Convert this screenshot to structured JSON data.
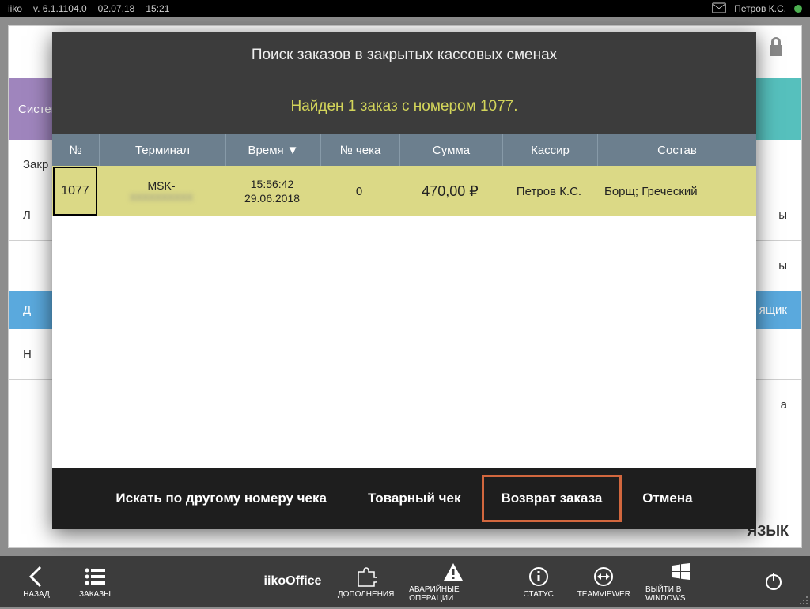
{
  "sysbar": {
    "app": "iiko",
    "version": "v. 6.1.1104.0",
    "date": "02.07.18",
    "time": "15:21",
    "user": "Петров К.С."
  },
  "bg": {
    "tab_left": "Систем",
    "rows": [
      "Закр",
      "Л",
      "",
      "Д",
      "Н",
      ""
    ],
    "rows_right": [
      "",
      "ы",
      "ы",
      "ящик",
      "",
      "а"
    ],
    "lang": "ЯЗЫК"
  },
  "dialog": {
    "title": "Поиск заказов в закрытых кассовых сменах",
    "subtitle": "Найден 1 заказ с номером 1077.",
    "columns": {
      "num": "№",
      "terminal": "Терминал",
      "time": "Время",
      "check": "№ чека",
      "sum": "Сумма",
      "cashier": "Кассир",
      "composition": "Состав"
    },
    "rows": [
      {
        "num": "1077",
        "terminal_top": "MSK-",
        "terminal_bottom": "XXXXXXXXXX",
        "time_top": "15:56:42",
        "time_bottom": "29.06.2018",
        "check": "0",
        "sum": "470,00 ₽",
        "cashier": "Петров К.С.",
        "composition": "Борщ; Греческий"
      }
    ],
    "buttons": {
      "search_other": "Искать по другому номеру чека",
      "receipt": "Товарный чек",
      "refund": "Возврат заказа",
      "cancel": "Отмена"
    }
  },
  "toolbar": {
    "back": "НАЗАД",
    "orders": "ЗАКАЗЫ",
    "office": "iikoOffice",
    "addons": "ДОПОЛНЕНИЯ",
    "emergency": "АВАРИЙНЫЕ ОПЕРАЦИИ",
    "status": "СТАТУС",
    "teamviewer": "TEAMVIEWER",
    "exit_windows": "ВЫЙТИ В WINDOWS"
  }
}
